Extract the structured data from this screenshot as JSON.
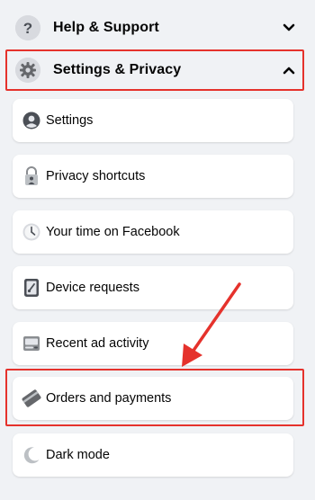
{
  "menu": {
    "help_support": {
      "label": "Help & Support",
      "icon": "question-mark-icon"
    },
    "settings_privacy": {
      "label": "Settings & Privacy",
      "icon": "gear-icon"
    },
    "items": [
      {
        "label": "Settings",
        "icon": "profile-icon"
      },
      {
        "label": "Privacy shortcuts",
        "icon": "lock-icon"
      },
      {
        "label": "Your time on Facebook",
        "icon": "clock-icon"
      },
      {
        "label": "Device requests",
        "icon": "device-icon"
      },
      {
        "label": "Recent ad activity",
        "icon": "ad-activity-icon"
      },
      {
        "label": "Orders and payments",
        "icon": "card-icon"
      },
      {
        "label": "Dark mode",
        "icon": "moon-icon"
      }
    ]
  },
  "colors": {
    "background": "#f0f2f5",
    "card": "#ffffff",
    "highlight": "#e5322c",
    "text": "#050505"
  }
}
